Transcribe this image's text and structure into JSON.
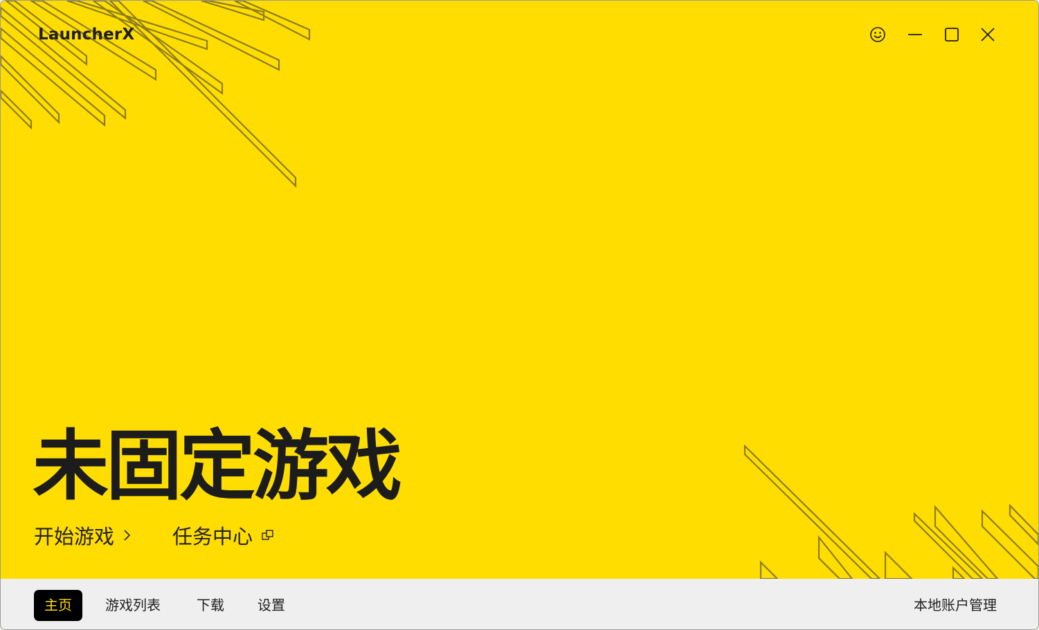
{
  "app": {
    "title": "LauncherX"
  },
  "window_controls": {
    "feedback_icon": "smiley-icon",
    "minimize_icon": "minimize-icon",
    "maximize_icon": "maximize-icon",
    "close_icon": "close-icon"
  },
  "hero": {
    "headline": "未固定游戏",
    "actions": {
      "start_game": {
        "label": "开始游戏",
        "icon": "chevron-right-icon"
      },
      "task_center": {
        "label": "任务中心",
        "icon": "external-window-icon"
      }
    }
  },
  "nav": {
    "items": [
      {
        "label": "主页",
        "active": true
      },
      {
        "label": "游戏列表",
        "active": false
      },
      {
        "label": "下载",
        "active": false
      },
      {
        "label": "设置",
        "active": false
      }
    ],
    "account_label": "本地账户管理"
  },
  "colors": {
    "accent": "#FFDD00",
    "dark": "#1c1c1c",
    "stripe": "#8a7a18",
    "navbar_bg": "#efefef"
  }
}
